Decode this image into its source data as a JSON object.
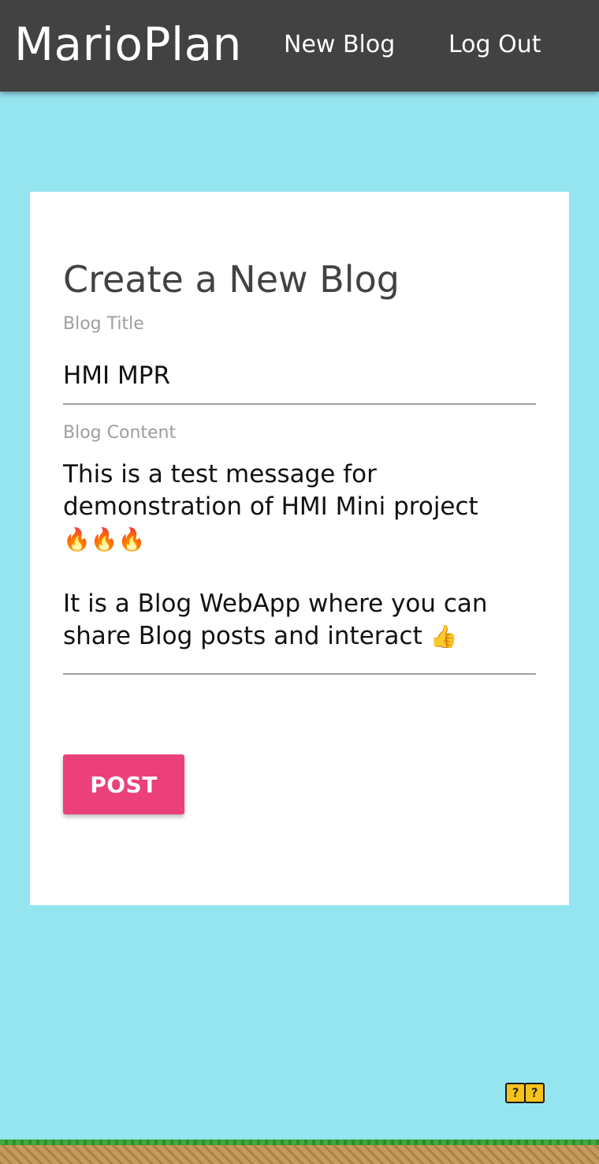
{
  "navbar": {
    "brand": "MarioPlan",
    "links": [
      {
        "label": "New Blog"
      },
      {
        "label": "Log Out"
      }
    ]
  },
  "form": {
    "title": "Create a New Blog",
    "title_field": {
      "label": "Blog Title",
      "value": "HMI MPR"
    },
    "content_field": {
      "label": "Blog Content",
      "line1": "This is a test message for",
      "line2": "demonstration of HMI Mini project",
      "line3_emojis": "🔥🔥🔥",
      "line4": "It is a Blog WebApp where you can",
      "line5": "share Blog posts and interact",
      "line5_emoji": "👍"
    },
    "submit_label": "POST"
  },
  "decor": {
    "question_block": "?",
    "colors": {
      "background": "#95e5f1",
      "navbar": "#424242",
      "button": "#ec407a"
    }
  }
}
